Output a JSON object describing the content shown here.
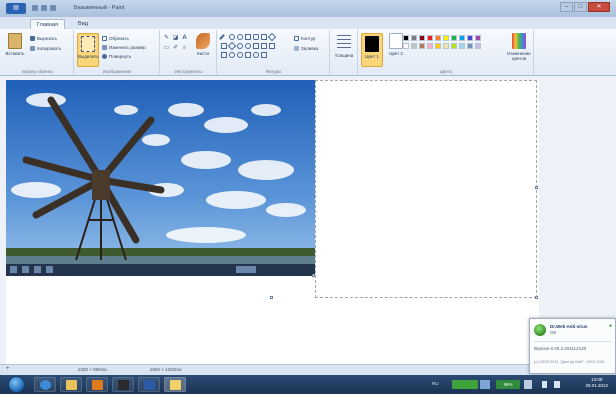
{
  "window": {
    "title": "Безымянный - Paint",
    "controls": {
      "minimize": "–",
      "maximize": "□",
      "close": "✕"
    },
    "app_menu": "▤"
  },
  "tabs": [
    {
      "label": "Главная",
      "active": true
    },
    {
      "label": "Вид",
      "active": false
    }
  ],
  "ribbon": {
    "clipboard": {
      "label": "Буфер обмена",
      "paste": "Вставить",
      "cut": "Вырезать",
      "copy": "Копировать"
    },
    "image": {
      "label": "Изображение",
      "select": "Выделить",
      "crop": "Обрезать",
      "resize": "Изменить размер",
      "rotate": "Повернуть"
    },
    "tools": {
      "label": "Инструменты",
      "pencil": "✎",
      "fill": "◪",
      "text": "A",
      "eraser": "▭",
      "picker": "✐",
      "magnifier": "⌕",
      "brushes": "Кисти"
    },
    "shapes": {
      "label": "Фигуры",
      "outline": "Контур",
      "fill": "Заливка"
    },
    "size": {
      "label": "Толщина"
    },
    "colors": {
      "label": "Цвета",
      "color1": "Цвет 1",
      "color2": "Цвет 2",
      "edit": "Изменение цветов",
      "color1_value": "#000000",
      "color2_value": "#ffffff",
      "palette": [
        "#000000",
        "#7f7f7f",
        "#880015",
        "#ed1c24",
        "#ff7f27",
        "#fff200",
        "#22b14c",
        "#00a2e8",
        "#3f48cc",
        "#a349a4",
        "#ffffff",
        "#c3c3c3",
        "#b97a57",
        "#ffaec9",
        "#ffc90e",
        "#efe4b0",
        "#b5e61d",
        "#99d9ea",
        "#7092be",
        "#c8bfe7"
      ]
    }
  },
  "status": {
    "image_size": "2300 × 980пкс",
    "canvas_size": "2650 × 1092пкс",
    "add_icon": "+"
  },
  "notification": {
    "title": "Dr.Web Anti-virus",
    "status": "ОК",
    "version": "Версия 6.00.3.201112120",
    "copyright": "(c) 2003-2011 \"Доктор Веб\", 1992-2011"
  },
  "clock": {
    "time": "13:09",
    "date": "29.01.2012"
  },
  "tray": {
    "lang": "RU",
    "battery_label": "96%"
  }
}
